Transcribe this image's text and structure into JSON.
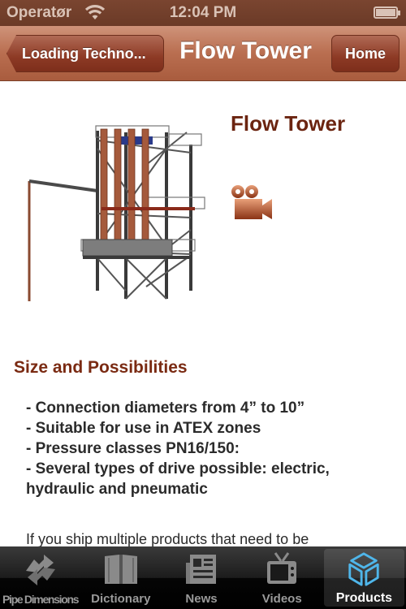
{
  "status_bar": {
    "carrier": "Operatør",
    "time": "12:04 PM",
    "wifi_icon": "wifi-icon",
    "battery_icon": "battery-icon"
  },
  "nav_bar": {
    "back_label": "Loading Techno...",
    "title": "Flow Tower",
    "home_label": "Home"
  },
  "product": {
    "title": "Flow Tower",
    "image": "flow-tower-image",
    "video_icon": "video-camera-icon",
    "section_title": "Size and Possibilities",
    "bullets": [
      "- Connection diameters from 4” to 10”",
      "- Suitable for use in ATEX zones",
      "- Pressure classes PN16/150:",
      "- Several types of drive possible: electric,\nhydraulic and pneumatic"
    ],
    "paragraph": "If you ship multiple products that need to be"
  },
  "tab_bar": {
    "tabs": [
      {
        "label": "Pipe Dimensions",
        "icon": "sync-arrows-icon",
        "selected": false
      },
      {
        "label": "Dictionary",
        "icon": "book-icon",
        "selected": false
      },
      {
        "label": "News",
        "icon": "newspaper-icon",
        "selected": false
      },
      {
        "label": "Videos",
        "icon": "tv-icon",
        "selected": false
      },
      {
        "label": "Products",
        "icon": "cube-icon",
        "selected": true
      }
    ]
  },
  "colors": {
    "nav_bar": "#b96e50",
    "status_bar": "#6b3a27",
    "heading": "#6b2410",
    "selected_tab_icon": "#4fb6ea"
  }
}
